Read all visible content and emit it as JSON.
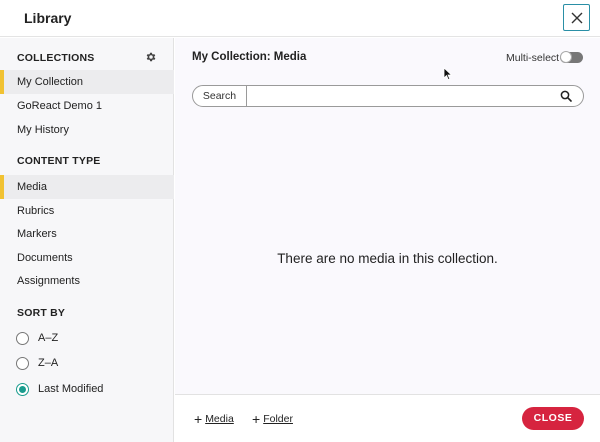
{
  "header": {
    "title": "Library"
  },
  "sidebar": {
    "collections_heading": "COLLECTIONS",
    "collections": [
      {
        "label": "My Collection",
        "active": true
      },
      {
        "label": "GoReact Demo 1",
        "active": false
      },
      {
        "label": "My History",
        "active": false
      }
    ],
    "content_type_heading": "CONTENT TYPE",
    "content_types": [
      {
        "label": "Media",
        "active": true
      },
      {
        "label": "Rubrics",
        "active": false
      },
      {
        "label": "Markers",
        "active": false
      },
      {
        "label": "Documents",
        "active": false
      },
      {
        "label": "Assignments",
        "active": false
      }
    ],
    "sort_heading": "SORT BY",
    "sort_options": [
      {
        "label": "A–Z",
        "checked": false
      },
      {
        "label": "Z–A",
        "checked": false
      },
      {
        "label": "Last Modified",
        "checked": true
      }
    ]
  },
  "main": {
    "title": "My Collection: Media",
    "multi_select_label": "Multi-select",
    "multi_select_on": false,
    "search_label": "Search",
    "search_value": "",
    "empty_message": "There are no media in this collection."
  },
  "footer": {
    "add_media_label": "Media",
    "add_folder_label": "Folder",
    "close_label": "CLOSE"
  },
  "colors": {
    "accent_active": "#f1c232",
    "radio_checked": "#1a9c8e",
    "close_button": "#d6243f",
    "close_x_border": "#2a8fa6"
  },
  "icons": [
    "close-icon",
    "gear-icon",
    "search-icon",
    "plus-icon",
    "cursor-icon"
  ]
}
